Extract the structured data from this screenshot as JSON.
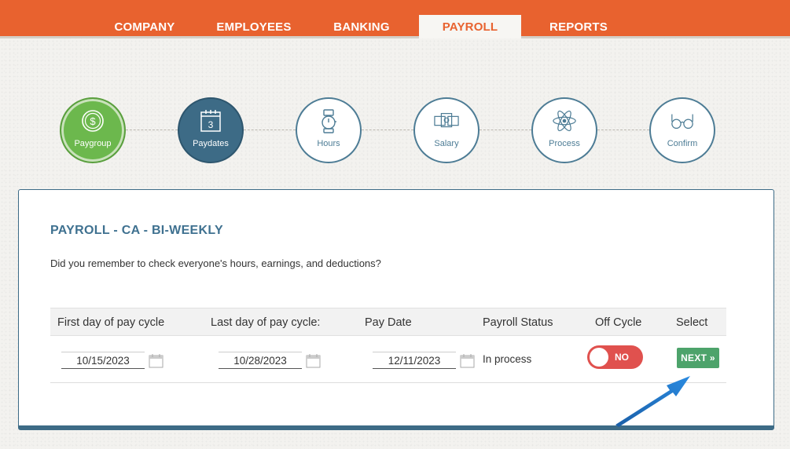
{
  "nav": {
    "tabs": [
      {
        "label": "COMPANY",
        "active": false
      },
      {
        "label": "EMPLOYEES",
        "active": false
      },
      {
        "label": "BANKING",
        "active": false
      },
      {
        "label": "PAYROLL",
        "active": true
      },
      {
        "label": "REPORTS",
        "active": false
      }
    ]
  },
  "steps": [
    {
      "label": "Paygroup",
      "icon": "dollar-coin-icon",
      "state": "completed"
    },
    {
      "label": "Paydates",
      "icon": "calendar-icon",
      "state": "current"
    },
    {
      "label": "Hours",
      "icon": "stopwatch-icon",
      "state": "pending"
    },
    {
      "label": "Salary",
      "icon": "money-bills-icon",
      "state": "pending"
    },
    {
      "label": "Process",
      "icon": "atom-icon",
      "state": "pending"
    },
    {
      "label": "Confirm",
      "icon": "glasses-icon",
      "state": "pending"
    }
  ],
  "calendar_icon_day": "3",
  "card": {
    "title": "PAYROLL - CA - BI-WEEKLY",
    "question": "Did you remember to check everyone's hours, earnings, and deductions?",
    "table": {
      "headers": [
        "First day of pay cycle",
        "Last day of pay cycle:",
        "Pay Date",
        "Payroll Status",
        "Off Cycle",
        "Select"
      ],
      "row": {
        "first_day": "10/15/2023",
        "last_day": "10/28/2023",
        "pay_date": "12/11/2023",
        "status": "In process",
        "off_cycle": "NO",
        "select_label": "NEXT »"
      }
    }
  },
  "colors": {
    "brand_orange": "#e8622f",
    "step_blue": "#3d6b86",
    "step_green": "#6cb84d",
    "toggle_red": "#e0514e",
    "next_green": "#4da36b",
    "arrow_blue": "#1a74c9"
  }
}
